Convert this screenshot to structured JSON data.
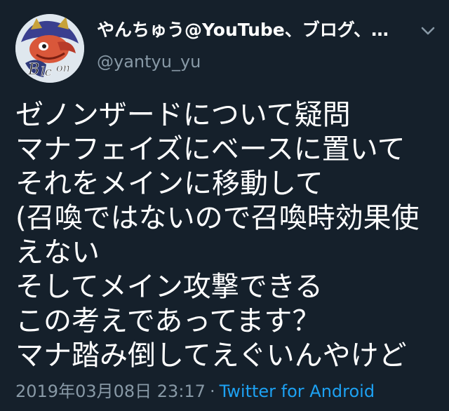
{
  "user": {
    "display_name": "やんちゅう@YouTube、ブログ、…",
    "handle": "@yantyu_yu"
  },
  "tweet": {
    "lines": [
      "ゼノンザードについて疑問",
      "マナフェイズにベースに置いて",
      "それをメインに移動して",
      "(召喚ではないので召喚時効果使",
      "えない",
      "そしてメイン攻撃できる",
      "この考えであってます？",
      "マナ踏み倒してえぐいんやけど"
    ],
    "timestamp": "2019年03月08日 23:17",
    "separator": "·",
    "source": "Twitter for Android"
  },
  "icons": {
    "avatar": "avatar-illustration",
    "menu": "chevron-down-icon"
  },
  "colors": {
    "background": "#15202b",
    "primary_text": "#ffffff",
    "secondary_text": "#8899a6",
    "link": "#1da1f2"
  }
}
